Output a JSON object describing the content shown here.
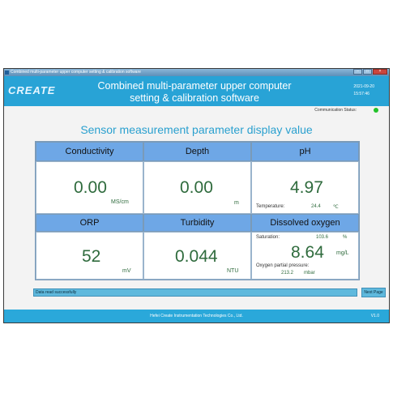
{
  "window": {
    "title": "Combined multi-parameter upper computer setting & calibration software"
  },
  "header": {
    "logo": "CREATE",
    "title_line1": "Combined multi-parameter upper computer",
    "title_line2": "setting & calibration software",
    "date": "2021-09-20",
    "time": "15:57:46"
  },
  "status": {
    "label": "Communication Status:",
    "color": "#22c22a"
  },
  "main": {
    "title": "Sensor measurement parameter display value"
  },
  "cells": {
    "conductivity": {
      "header": "Conductivity",
      "value": "0.00",
      "unit": "MS/cm"
    },
    "depth": {
      "header": "Depth",
      "value": "0.00",
      "unit": "m"
    },
    "ph": {
      "header": "pH",
      "value": "4.97",
      "temp_label": "Temperature:",
      "temp_value": "24.4",
      "temp_unit": "℃"
    },
    "orp": {
      "header": "ORP",
      "value": "52",
      "unit": "mV"
    },
    "turbidity": {
      "header": "Turbidity",
      "value": "0.044",
      "unit": "NTU"
    },
    "do": {
      "header": "Dissolved oxygen",
      "saturation_label": "Saturation:",
      "saturation_value": "103.6",
      "saturation_unit": "%",
      "value": "8.64",
      "unit": "mg/L",
      "pressure_label": "Oxygen partial pressure:",
      "pressure_value": "213.2",
      "pressure_unit": "mbar"
    }
  },
  "messages": {
    "status_text": "Data read successfully",
    "next_button": "Next Page"
  },
  "footer": {
    "company": "Hefei Create Instrumentation Technologies Co., Ltd.",
    "version": "V1.0"
  },
  "colors": {
    "header_bg": "#28a3d6",
    "cell_header_bg": "#6ea7e6",
    "value_color": "#2f6b3d",
    "title_color": "#2aa0cf"
  }
}
